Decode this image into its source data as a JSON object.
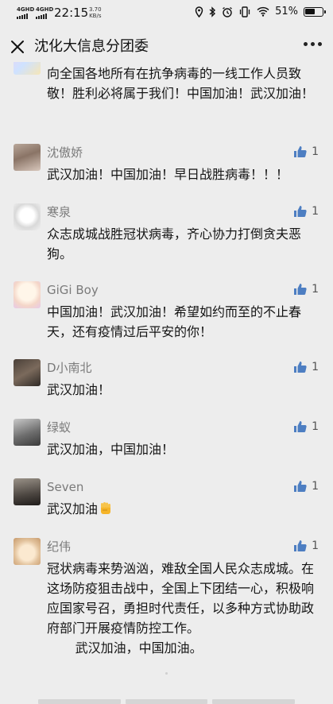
{
  "status_bar": {
    "sim1": "4GHD",
    "sim2": "4GHD",
    "time": "22:15",
    "speed_value": "3.70",
    "speed_unit": "KB/s",
    "battery": "51%"
  },
  "nav": {
    "title": "沈化大信息分团委"
  },
  "comments": [
    {
      "name": "",
      "text": "向全国各地所有在抗争病毒的一线工作人员致敬！胜利必将属于我们！中国加油！武汉加油！",
      "likes": ""
    },
    {
      "name": "沈傲娇",
      "text": "武汉加油！中国加油！早日战胜病毒！！！",
      "likes": "1"
    },
    {
      "name": "寒泉",
      "text": "众志成城战胜冠状病毒，齐心协力打倒贪夫恶狗。",
      "likes": "1"
    },
    {
      "name": "GiGi Boy",
      "text": "中国加油！武汉加油！希望如约而至的不止春天，还有疫情过后平安的你！",
      "likes": "1"
    },
    {
      "name": "D小南北",
      "text": "武汉加油！",
      "likes": "1"
    },
    {
      "name": "绿蚁",
      "text": "武汉加油，中国加油！",
      "likes": "1"
    },
    {
      "name": "Seven",
      "text": "武汉加油",
      "likes": "1"
    },
    {
      "name": "纪伟",
      "text": "冠状病毒来势汹汹，难敌全国人民众志成城。在这场防疫狙击战中，全国上下团结一心，积极响应国家号召，勇担时代责任，以多种方式协助政府部门开展疫情防控工作。\n       武汉加油，中国加油。",
      "likes": "1"
    }
  ],
  "colors": {
    "background": "#ededed",
    "name_text": "#7a7a7a",
    "body_text": "#141414",
    "like_icon": "#4d7ec2"
  },
  "icons": {
    "close": "close-icon",
    "more": "more-icon",
    "like": "thumbs-up-icon",
    "emoji": "raised-fist-emoji"
  }
}
